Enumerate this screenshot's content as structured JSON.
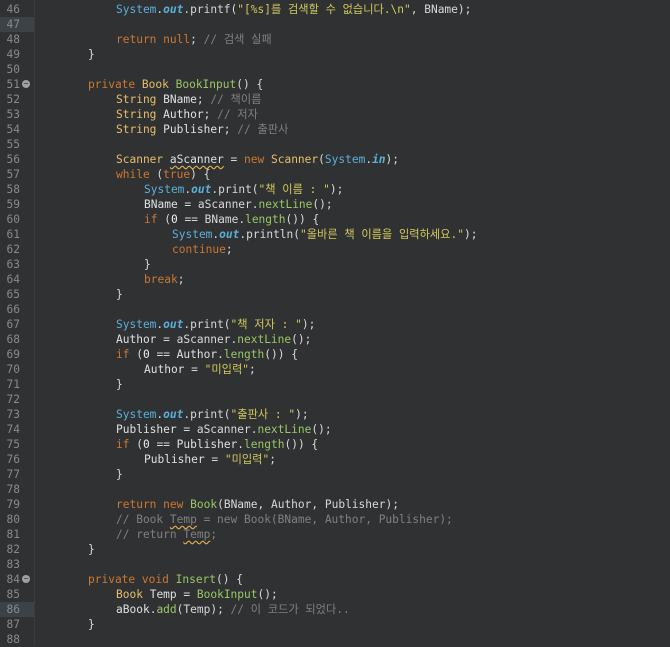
{
  "line_numbers": [
    "46",
    "47",
    "48",
    "49",
    "50",
    "51",
    "52",
    "53",
    "54",
    "55",
    "56",
    "57",
    "58",
    "59",
    "60",
    "61",
    "62",
    "63",
    "64",
    "65",
    "66",
    "67",
    "68",
    "69",
    "70",
    "71",
    "72",
    "73",
    "74",
    "75",
    "76",
    "77",
    "78",
    "79",
    "80",
    "81",
    "82",
    "83",
    "84",
    "85",
    "86",
    "87",
    "88"
  ],
  "code_lines": [
    [
      [
        "sys",
        "System"
      ],
      [
        "p",
        "."
      ],
      [
        "i",
        "out"
      ],
      [
        "p",
        ".printf("
      ],
      [
        "s",
        "\"[%s]를 검색할 수 없습니다.\\n\""
      ],
      [
        "p",
        ", BName);"
      ]
    ],
    [],
    [
      [
        "k",
        "return"
      ],
      [
        "p",
        " "
      ],
      [
        "k",
        "null"
      ],
      [
        "p",
        "; "
      ],
      [
        "c",
        "// 검색 실패"
      ]
    ],
    [
      [
        "p",
        "}"
      ]
    ],
    [],
    [
      [
        "k",
        "private"
      ],
      [
        "p",
        " "
      ],
      [
        "t",
        "Book"
      ],
      [
        "p",
        " "
      ],
      [
        "f",
        "BookInput"
      ],
      [
        "p",
        "() {"
      ]
    ],
    [
      [
        "t",
        "String"
      ],
      [
        "p",
        " "
      ],
      [
        "v",
        "BName"
      ],
      [
        "p",
        "; "
      ],
      [
        "c",
        "// 책이름"
      ]
    ],
    [
      [
        "t",
        "String"
      ],
      [
        "p",
        " "
      ],
      [
        "v",
        "Author"
      ],
      [
        "p",
        "; "
      ],
      [
        "c",
        "// 저자"
      ]
    ],
    [
      [
        "t",
        "String"
      ],
      [
        "p",
        " "
      ],
      [
        "v",
        "Publisher"
      ],
      [
        "p",
        "; "
      ],
      [
        "c",
        "// 출판사"
      ]
    ],
    [],
    [
      [
        "t",
        "Scanner"
      ],
      [
        "p",
        " "
      ],
      [
        "v wavy",
        "aScanner"
      ],
      [
        "p",
        " = "
      ],
      [
        "k",
        "new"
      ],
      [
        "p",
        " "
      ],
      [
        "t",
        "Scanner"
      ],
      [
        "p",
        "("
      ],
      [
        "sys",
        "System"
      ],
      [
        "p",
        "."
      ],
      [
        "i",
        "in"
      ],
      [
        "p",
        ");"
      ]
    ],
    [
      [
        "k",
        "while"
      ],
      [
        "p",
        " ("
      ],
      [
        "k",
        "true"
      ],
      [
        "p",
        ") {"
      ]
    ],
    [
      [
        "sys",
        "System"
      ],
      [
        "p",
        "."
      ],
      [
        "i",
        "out"
      ],
      [
        "p",
        ".print("
      ],
      [
        "s",
        "\"책 이름 : \""
      ],
      [
        "p",
        ");"
      ]
    ],
    [
      [
        "v",
        "BName"
      ],
      [
        "p",
        " = aScanner."
      ],
      [
        "f",
        "nextLine"
      ],
      [
        "p",
        "();"
      ]
    ],
    [
      [
        "k",
        "if"
      ],
      [
        "p",
        " ("
      ],
      [
        "n",
        "0"
      ],
      [
        "p",
        " == BName."
      ],
      [
        "f",
        "length"
      ],
      [
        "p",
        "()) {"
      ]
    ],
    [
      [
        "sys",
        "System"
      ],
      [
        "p",
        "."
      ],
      [
        "i",
        "out"
      ],
      [
        "p",
        ".println("
      ],
      [
        "s",
        "\"올바른 책 이름을 입력하세요.\""
      ],
      [
        "p",
        ");"
      ]
    ],
    [
      [
        "k",
        "continue"
      ],
      [
        "p",
        ";"
      ]
    ],
    [
      [
        "p",
        "}"
      ]
    ],
    [
      [
        "k",
        "break"
      ],
      [
        "p",
        ";"
      ]
    ],
    [
      [
        "p",
        "}"
      ]
    ],
    [],
    [
      [
        "sys",
        "System"
      ],
      [
        "p",
        "."
      ],
      [
        "i",
        "out"
      ],
      [
        "p",
        ".print("
      ],
      [
        "s",
        "\"책 저자 : \""
      ],
      [
        "p",
        ");"
      ]
    ],
    [
      [
        "v",
        "Author"
      ],
      [
        "p",
        " = aScanner."
      ],
      [
        "f",
        "nextLine"
      ],
      [
        "p",
        "();"
      ]
    ],
    [
      [
        "k",
        "if"
      ],
      [
        "p",
        " ("
      ],
      [
        "n",
        "0"
      ],
      [
        "p",
        " == "
      ],
      [
        "v",
        "Author"
      ],
      [
        "p",
        "."
      ],
      [
        "f",
        "length"
      ],
      [
        "p",
        "()) {"
      ]
    ],
    [
      [
        "v",
        "Author"
      ],
      [
        "p",
        " = "
      ],
      [
        "s",
        "\"미입력\""
      ],
      [
        "p",
        ";"
      ]
    ],
    [
      [
        "p",
        "}"
      ]
    ],
    [],
    [
      [
        "sys",
        "System"
      ],
      [
        "p",
        "."
      ],
      [
        "i",
        "out"
      ],
      [
        "p",
        ".print("
      ],
      [
        "s",
        "\"출판사 : \""
      ],
      [
        "p",
        ");"
      ]
    ],
    [
      [
        "v",
        "Publisher"
      ],
      [
        "p",
        " = aScanner."
      ],
      [
        "f",
        "nextLine"
      ],
      [
        "p",
        "();"
      ]
    ],
    [
      [
        "k",
        "if"
      ],
      [
        "p",
        " ("
      ],
      [
        "n",
        "0"
      ],
      [
        "p",
        " == "
      ],
      [
        "v",
        "Publisher"
      ],
      [
        "p",
        "."
      ],
      [
        "f",
        "length"
      ],
      [
        "p",
        "()) {"
      ]
    ],
    [
      [
        "v",
        "Publisher"
      ],
      [
        "p",
        " = "
      ],
      [
        "s",
        "\"미입력\""
      ],
      [
        "p",
        ";"
      ]
    ],
    [
      [
        "p",
        "}"
      ]
    ],
    [],
    [
      [
        "k",
        "return"
      ],
      [
        "p",
        " "
      ],
      [
        "k",
        "new"
      ],
      [
        "p",
        " "
      ],
      [
        "f",
        "Book"
      ],
      [
        "p",
        "(BName, Author, Publisher);"
      ]
    ],
    [
      [
        "c",
        "// Book "
      ],
      [
        "c wavy",
        "Temp"
      ],
      [
        "c",
        " = new Book(BName, Author, Publisher);"
      ]
    ],
    [
      [
        "c",
        "// return "
      ],
      [
        "c wavy",
        "Temp"
      ],
      [
        "c",
        ";"
      ]
    ],
    [
      [
        "p",
        "}"
      ]
    ],
    [],
    [
      [
        "k",
        "private"
      ],
      [
        "p",
        " "
      ],
      [
        "k",
        "void"
      ],
      [
        "p",
        " "
      ],
      [
        "f",
        "Insert"
      ],
      [
        "p",
        "() {"
      ]
    ],
    [
      [
        "t",
        "Book"
      ],
      [
        "p",
        " "
      ],
      [
        "v",
        "Temp"
      ],
      [
        "p",
        " = "
      ],
      [
        "f",
        "BookInput"
      ],
      [
        "p",
        "();"
      ]
    ],
    [
      [
        "v",
        "aBook"
      ],
      [
        "p",
        "."
      ],
      [
        "f",
        "add"
      ],
      [
        "p",
        "(Temp); "
      ],
      [
        "c",
        "// 이 코드가 되었다.."
      ]
    ],
    [
      [
        "p",
        "}"
      ]
    ],
    []
  ]
}
